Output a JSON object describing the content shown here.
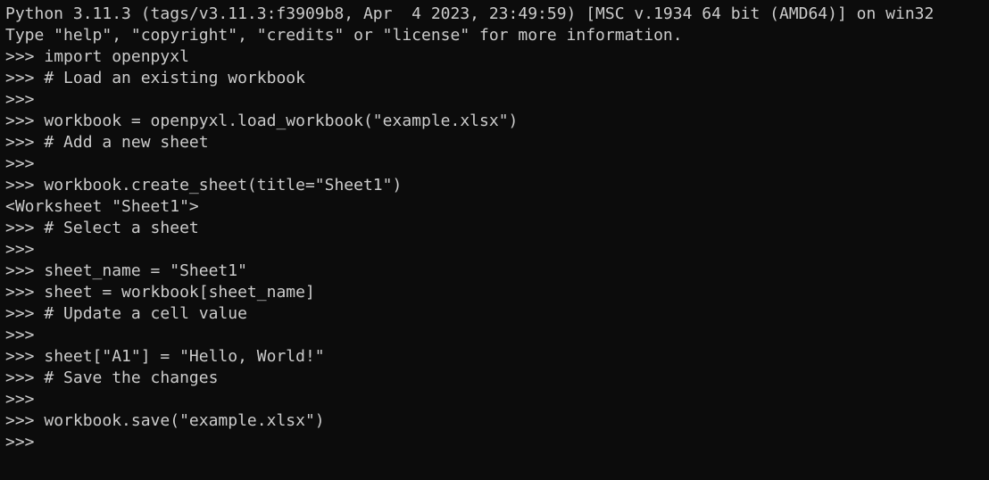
{
  "terminal": {
    "prompt": ">>> ",
    "lines": [
      {
        "kind": "output",
        "text": "Python 3.11.3 (tags/v3.11.3:f3909b8, Apr  4 2023, 23:49:59) [MSC v.1934 64 bit (AMD64)] on win32"
      },
      {
        "kind": "output",
        "text": "Type \"help\", \"copyright\", \"credits\" or \"license\" for more information."
      },
      {
        "kind": "input",
        "prompt": ">>>",
        "text": " import openpyxl"
      },
      {
        "kind": "input",
        "prompt": ">>>",
        "text": " # Load an existing workbook"
      },
      {
        "kind": "input",
        "prompt": ">>>",
        "text": ""
      },
      {
        "kind": "input",
        "prompt": ">>>",
        "text": " workbook = openpyxl.load_workbook(\"example.xlsx\")"
      },
      {
        "kind": "input",
        "prompt": ">>>",
        "text": " # Add a new sheet"
      },
      {
        "kind": "input",
        "prompt": ">>>",
        "text": ""
      },
      {
        "kind": "input",
        "prompt": ">>>",
        "text": " workbook.create_sheet(title=\"Sheet1\")"
      },
      {
        "kind": "output",
        "text": "<Worksheet \"Sheet1\">"
      },
      {
        "kind": "input",
        "prompt": ">>>",
        "text": " # Select a sheet"
      },
      {
        "kind": "input",
        "prompt": ">>>",
        "text": ""
      },
      {
        "kind": "input",
        "prompt": ">>>",
        "text": " sheet_name = \"Sheet1\""
      },
      {
        "kind": "input",
        "prompt": ">>>",
        "text": " sheet = workbook[sheet_name]"
      },
      {
        "kind": "input",
        "prompt": ">>>",
        "text": " # Update a cell value"
      },
      {
        "kind": "input",
        "prompt": ">>>",
        "text": ""
      },
      {
        "kind": "input",
        "prompt": ">>>",
        "text": " sheet[\"A1\"] = \"Hello, World!\""
      },
      {
        "kind": "input",
        "prompt": ">>>",
        "text": " # Save the changes"
      },
      {
        "kind": "input",
        "prompt": ">>>",
        "text": ""
      },
      {
        "kind": "input",
        "prompt": ">>>",
        "text": " workbook.save(\"example.xlsx\")"
      },
      {
        "kind": "input",
        "prompt": ">>>",
        "text": ""
      }
    ]
  },
  "colors": {
    "background": "#0c0c0c",
    "foreground": "#cccccc"
  }
}
